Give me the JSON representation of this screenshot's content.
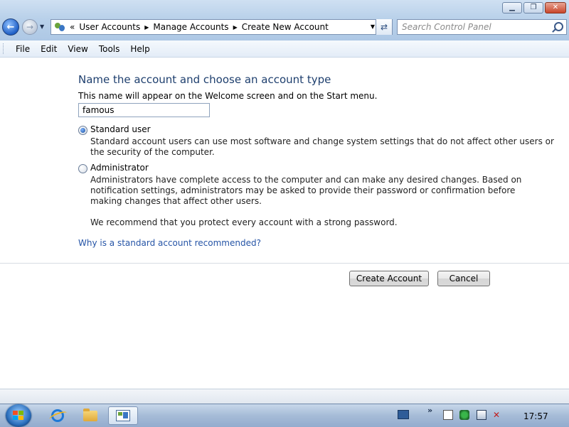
{
  "window": {
    "minimize_glyph": "▁",
    "maximize_glyph": "❐",
    "close_glyph": "✕"
  },
  "address_bar": {
    "overflow": "«",
    "breadcrumbs": [
      "User Accounts",
      "Manage Accounts",
      "Create New Account"
    ],
    "separator": "▶"
  },
  "search": {
    "placeholder": "Search Control Panel"
  },
  "menu": {
    "items": [
      "File",
      "Edit",
      "View",
      "Tools",
      "Help"
    ]
  },
  "content": {
    "heading": "Name the account and choose an account type",
    "description": "This name will appear on the Welcome screen and on the Start menu.",
    "account_name": "famous",
    "options": [
      {
        "label": "Standard user",
        "selected": true,
        "description_lines": [
          "Standard account users can use most software and change system settings that do not affect other users or",
          "the security of the computer."
        ]
      },
      {
        "label": "Administrator",
        "selected": false,
        "description_lines": [
          "Administrators have complete access to the computer and can make any desired changes. Based on",
          "notification settings, administrators may be asked to provide their password or confirmation before",
          "making changes that affect other users."
        ]
      }
    ],
    "recommendation": "We recommend that you protect every account with a strong password.",
    "help_link": "Why is a standard account recommended?",
    "create_button": "Create Account",
    "cancel_button": "Cancel"
  },
  "taskbar": {
    "chevron": "»",
    "clock": "17:57"
  },
  "colors": {
    "heading": "#1e3f6e",
    "link": "#2554a6",
    "chrome": "#b9d1ea"
  }
}
